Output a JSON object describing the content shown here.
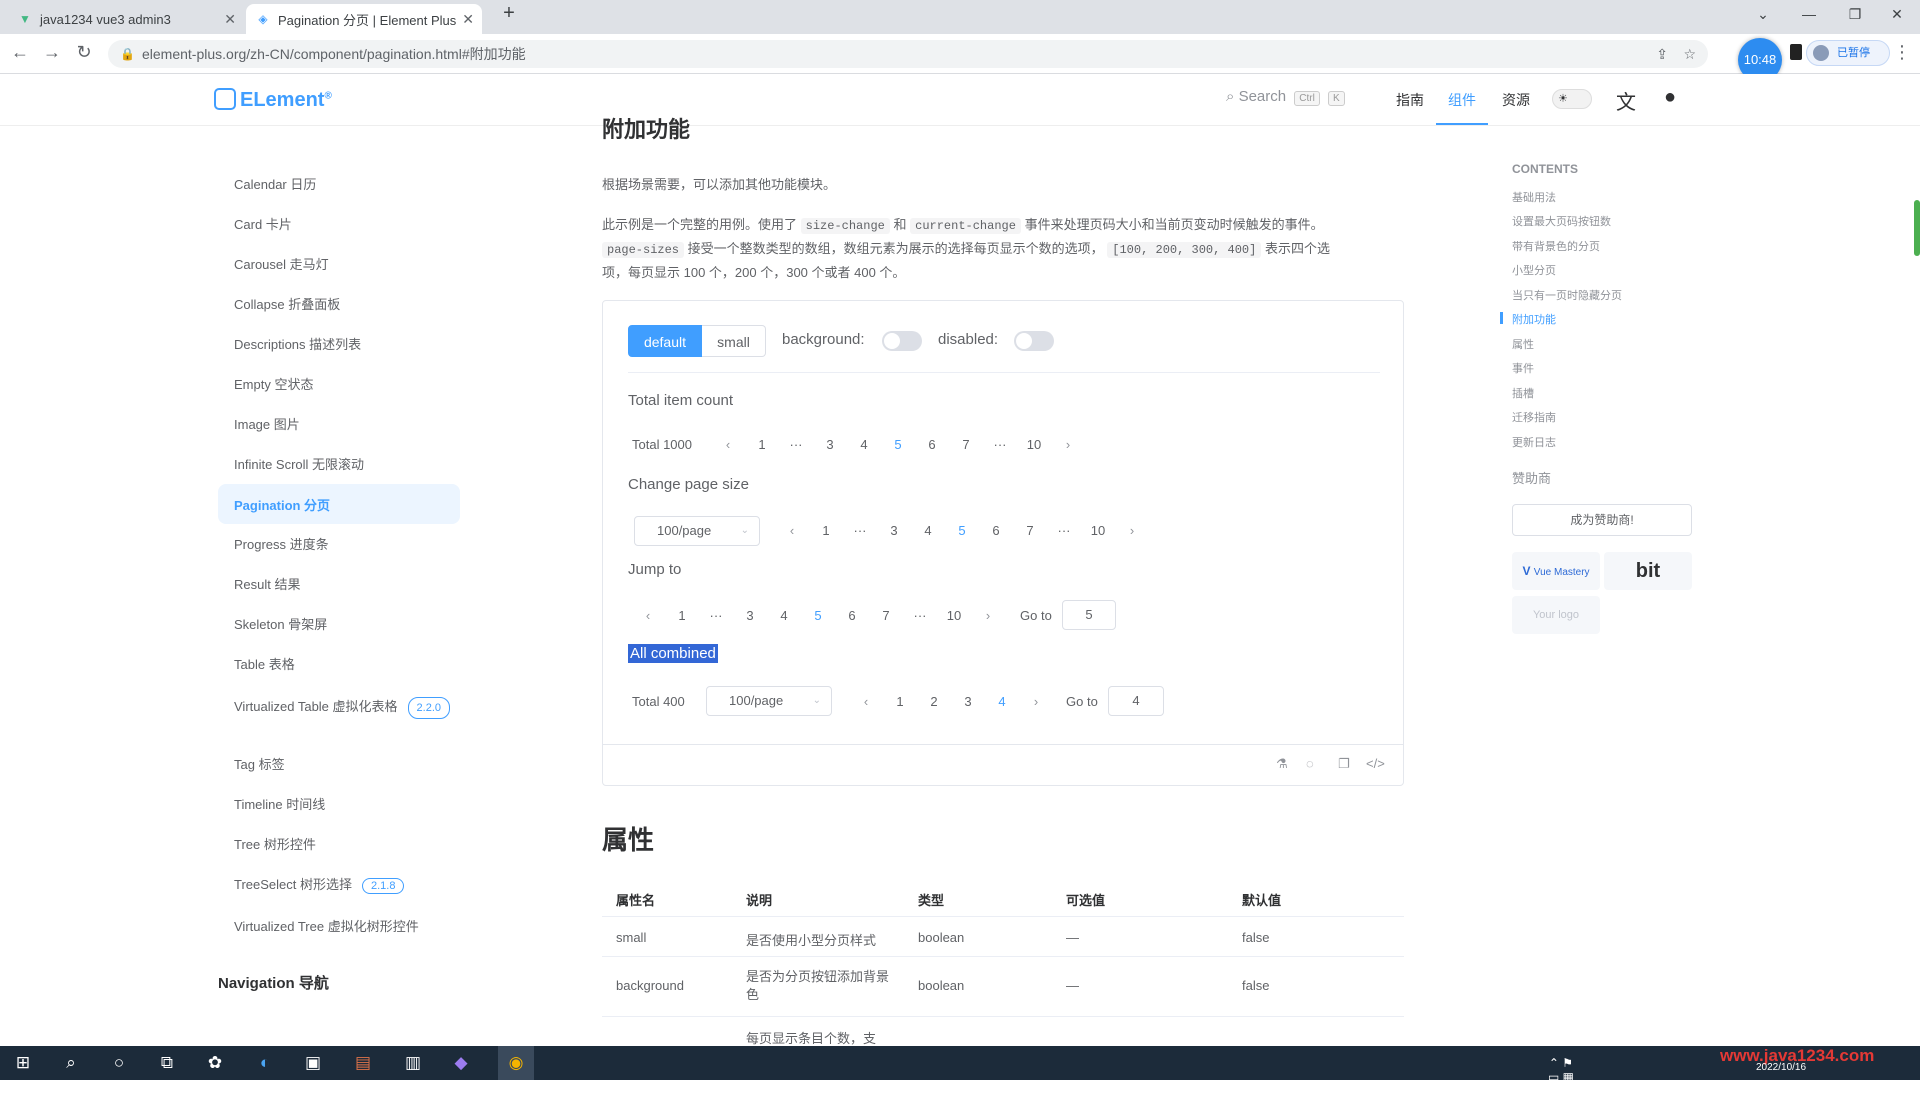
{
  "browser": {
    "tabs": [
      {
        "label": "java1234 vue3 admin3",
        "active": false
      },
      {
        "label": "Pagination 分页 | Element Plus",
        "active": true
      }
    ],
    "url": "element-plus.org/zh-CN/component/pagination.html#附加功能",
    "time_badge": "10:48",
    "profile_label": "已暂停"
  },
  "header": {
    "logo": "ELement",
    "search_placeholder": "Search",
    "kbd_ctrl": "Ctrl",
    "kbd_k": "K",
    "nav": [
      "指南",
      "组件",
      "资源"
    ]
  },
  "sidebar": {
    "items": [
      {
        "label": "Calendar 日历"
      },
      {
        "label": "Card 卡片"
      },
      {
        "label": "Carousel 走马灯"
      },
      {
        "label": "Collapse 折叠面板"
      },
      {
        "label": "Descriptions 描述列表"
      },
      {
        "label": "Empty 空状态"
      },
      {
        "label": "Image 图片"
      },
      {
        "label": "Infinite Scroll 无限滚动"
      },
      {
        "label": "Pagination 分页"
      },
      {
        "label": "Progress 进度条"
      },
      {
        "label": "Result 结果"
      },
      {
        "label": "Skeleton 骨架屏"
      },
      {
        "label": "Table 表格"
      },
      {
        "label": "Virtualized Table 虚拟化表格",
        "badge": "2.2.0"
      },
      {
        "label": "Tag 标签"
      },
      {
        "label": "Timeline 时间线"
      },
      {
        "label": "Tree 树形控件"
      },
      {
        "label": "TreeSelect 树形选择",
        "badge": "2.1.8"
      },
      {
        "label": "Virtualized Tree 虚拟化树形控件"
      }
    ],
    "group": "Navigation 导航"
  },
  "main": {
    "section_title": "附加功能",
    "intro": "根据场景需要，可以添加其他功能模块。",
    "desc_1a": "此示例是一个完整的用例。使用了",
    "desc_code1": "size-change",
    "desc_and": "和",
    "desc_code2": "current-change",
    "desc_1b": "事件来处理页码大小和当前页变动时候触发的事件。",
    "desc_code3": "page-sizes",
    "desc_2a": "接受一个整数类型的数组，数组元素为展示的选择每页显示个数的选项，",
    "desc_code4": "[100, 200, 300, 400]",
    "desc_2b": "表示四个选",
    "desc_3": "项，每页显示 100 个，200 个，300 个或者 400 个。",
    "demo": {
      "size_default": "default",
      "size_small": "small",
      "background_label": "background:",
      "disabled_label": "disabled:",
      "total_label": "Total item count",
      "total_text": "Total 1000",
      "pager_pages": [
        "1",
        "···",
        "3",
        "4",
        "5",
        "6",
        "7",
        "···",
        "10"
      ],
      "current_page": "5",
      "change_label": "Change page size",
      "page_size_value": "100/page",
      "jump_label": "Jump to",
      "goto_label": "Go to",
      "goto_value_jump": "5",
      "all_label": "All combined",
      "all_total": "Total 400",
      "all_pages": [
        "1",
        "2",
        "3",
        "4"
      ],
      "all_current": "4",
      "goto_value_all": "4"
    },
    "props_title": "属性",
    "table": {
      "headers": [
        "属性名",
        "说明",
        "类型",
        "可选值",
        "默认值"
      ],
      "rows": [
        [
          "small",
          "是否使用小型分页样式",
          "boolean",
          "—",
          "false"
        ],
        [
          "background",
          "是否为分页按钮添加背景色",
          "boolean",
          "—",
          "false"
        ],
        [
          "",
          "每页显示条目个数，支",
          "",
          "",
          ""
        ]
      ]
    }
  },
  "toc": {
    "title": "CONTENTS",
    "items": [
      "基础用法",
      "设置最大页码按钮数",
      "带有背景色的分页",
      "小型分页",
      "当只有一页时隐藏分页",
      "附加功能",
      "属性",
      "事件",
      "插槽",
      "迁移指南",
      "更新日志"
    ],
    "active": "附加功能",
    "sponsor_label": "赞助商",
    "sponsor_button": "成为赞助商!",
    "sponsor_card1": "Vue Mastery",
    "sponsor_card2": "bit",
    "sponsor_card3": "Your logo"
  },
  "taskbar": {
    "watermark": "www.java1234.com",
    "time": "2022/10/16"
  },
  "colors": {
    "primary": "#409eff",
    "sidebar_active_bg": "#ecf5ff",
    "selection": "#3367d6"
  }
}
